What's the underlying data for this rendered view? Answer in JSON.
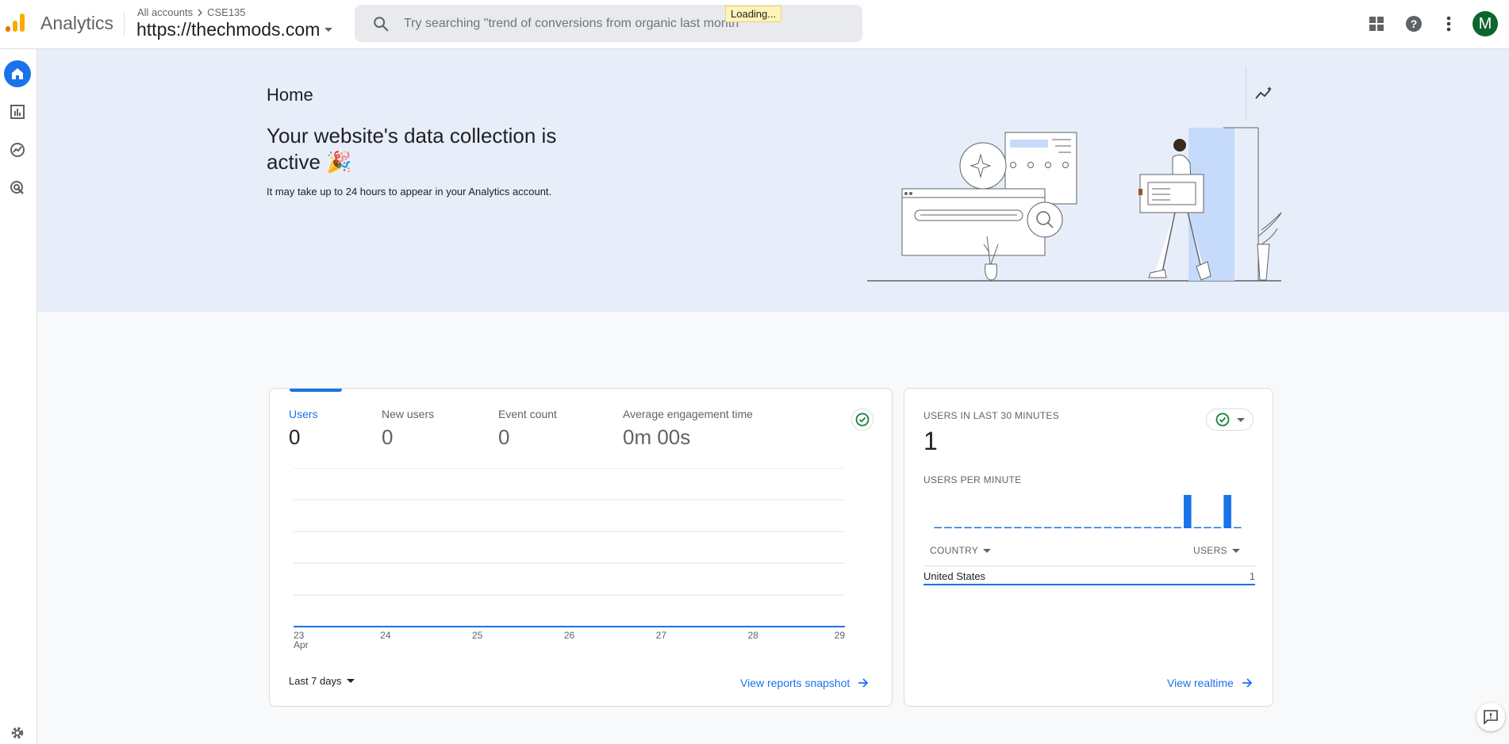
{
  "app": {
    "name": "Analytics",
    "breadcrumb_root": "All accounts",
    "breadcrumb_account": "CSE135",
    "property": "https://thechmods.com",
    "avatar_letter": "M",
    "loading_text": "Loading...",
    "brand_colors": {
      "logo_orange": "#f9ab00",
      "logo_dark": "#e37400",
      "accent": "#1a73e8",
      "avatar": "#0d652d"
    }
  },
  "search": {
    "placeholder": "Try searching \"trend of conversions from organic last month\""
  },
  "top_icons": [
    "apps-grid-icon",
    "help-icon",
    "more-vert-icon"
  ],
  "nav": {
    "items": [
      "home-icon",
      "reports-icon",
      "explore-icon",
      "advertising-icon"
    ],
    "active": "home-icon",
    "footer": "settings-icon"
  },
  "hero": {
    "title": "Home",
    "heading": "Your website's data collection is active 🎉",
    "subtext": "It may take up to 24 hours to appear in your Analytics account."
  },
  "overview_card": {
    "metrics": [
      {
        "label": "Users",
        "value": "0"
      },
      {
        "label": "New users",
        "value": "0"
      },
      {
        "label": "Event count",
        "value": "0"
      },
      {
        "label": "Average engagement time",
        "value": "0m 00s"
      }
    ],
    "date_range": "Last 7 days",
    "link": "View reports snapshot"
  },
  "chart_data": {
    "type": "line",
    "x": [
      "23 Apr",
      "24",
      "25",
      "26",
      "27",
      "28",
      "29"
    ],
    "series": [
      {
        "values": [
          0,
          0,
          0,
          0,
          0,
          0,
          0
        ]
      }
    ],
    "grid": true,
    "x_tick_labels": [
      "23",
      "24",
      "25",
      "26",
      "27",
      "28",
      "29"
    ],
    "x_month_label": "Apr"
  },
  "realtime_card": {
    "title": "USERS IN LAST 30 MINUTES",
    "value": "1",
    "sub_title": "USERS PER MINUTE",
    "per_minute": [
      0,
      0,
      0,
      0,
      0,
      0,
      0,
      0,
      0,
      0,
      0,
      0,
      0,
      0,
      0,
      0,
      0,
      0,
      0,
      0,
      0,
      0,
      0,
      0,
      0,
      1,
      0,
      0,
      0,
      1,
      0
    ],
    "col_country": "COUNTRY",
    "col_users": "USERS",
    "rows": [
      {
        "country": "United States",
        "users": "1"
      }
    ],
    "link": "View realtime"
  }
}
